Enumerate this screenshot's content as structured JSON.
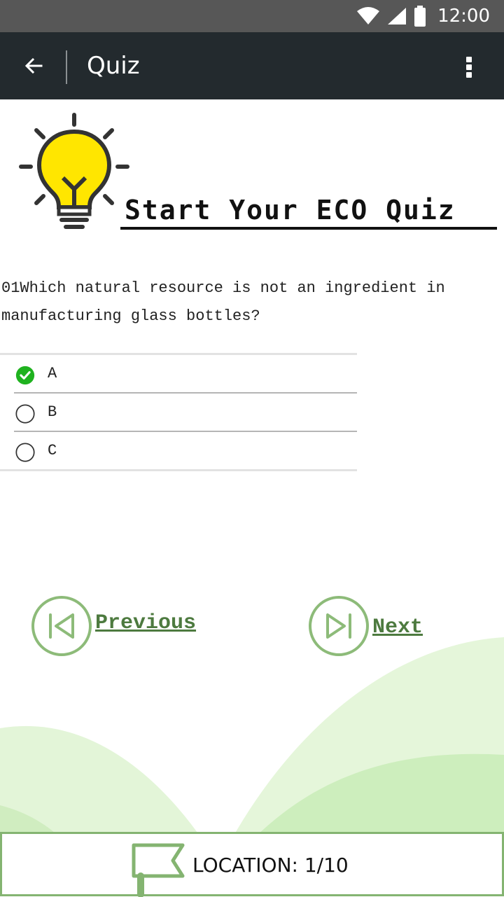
{
  "status_bar": {
    "time": "12:00"
  },
  "app_bar": {
    "title": "Quiz"
  },
  "banner": {
    "title": "Start Your ECO Quiz"
  },
  "question": {
    "text": "01Which natural resource is not an ingredient in manufacturing glass bottles?"
  },
  "options": [
    {
      "label": "A",
      "selected": true
    },
    {
      "label": "B",
      "selected": false
    },
    {
      "label": "C",
      "selected": false
    }
  ],
  "nav": {
    "previous_label": "Previous",
    "next_label": "Next"
  },
  "footer": {
    "location_label": "LOCATION:",
    "location_value": "1/10"
  },
  "colors": {
    "accent_green": "#84b471",
    "check_green": "#1fb21f",
    "app_bar": "#232a2e",
    "status_bar": "#575757"
  },
  "icons": [
    "back-arrow-icon",
    "more-vert-icon",
    "wifi-icon",
    "signal-icon",
    "battery-icon",
    "lightbulb-icon",
    "check-circle-icon",
    "radio-unchecked-icon",
    "previous-icon",
    "next-icon",
    "flag-icon"
  ]
}
